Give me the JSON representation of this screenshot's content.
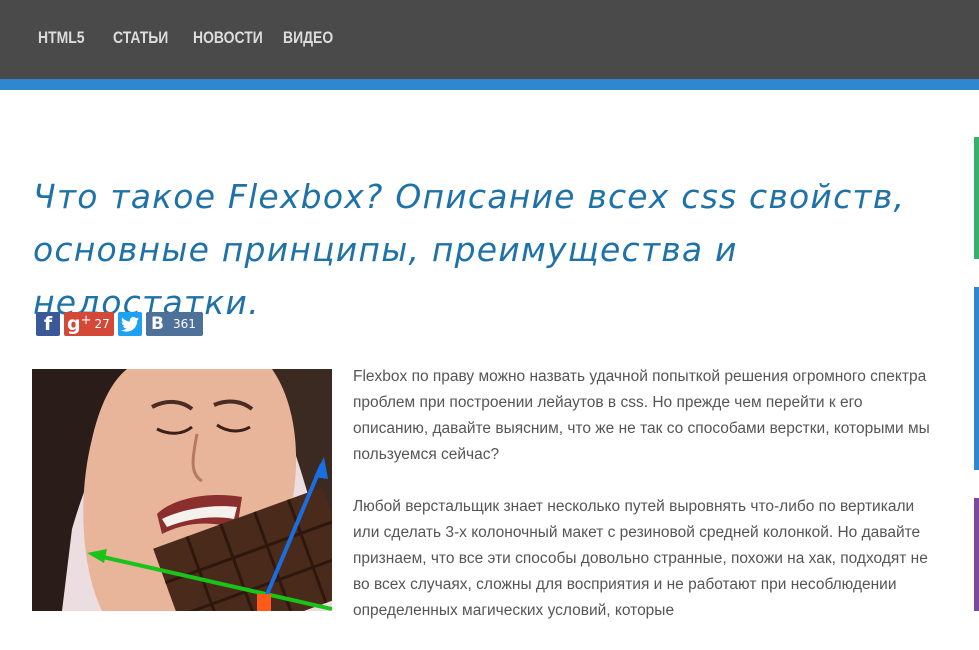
{
  "nav": {
    "items": [
      {
        "label": "HTML5"
      },
      {
        "label": "СТАТЬИ"
      },
      {
        "label": "НОВОСТИ"
      },
      {
        "label": "ВИДЕО"
      }
    ]
  },
  "article": {
    "title": "Что такое Flexbox? Описание всех css свойств, основные принципы, преимущества и недостатки.",
    "paragraphs": [
      "Flexbox по праву можно назвать удачной попыткой решения огромного спектра проблем при построении лейаутов в css. Но прежде чем перейти к его описанию, давайте выясним, что же не так со способами верстки, которыми мы пользуемся сейчас?",
      "Любой верстальщик знает несколько путей выровнять что-либо по вертикали или сделать 3-х колоночный макет с резиновой средней колонкой. Но давайте признаем, что все эти способы довольно странные, похожи на хак, подходят не во всех случаях, сложны для восприятия и не работают при несоблюдении определенных магических условий, которые"
    ]
  },
  "share": {
    "facebook_icon": "f",
    "googleplus_icon": "g",
    "googleplus_plus": "+",
    "googleplus_count": "27",
    "twitter_icon": "twitter-bird-icon",
    "vk_icon": "B",
    "vk_count": "361"
  },
  "colors": {
    "topbar": "#4a4a4a",
    "accent_blue": "#2e87cf",
    "title": "#1e72a8",
    "accent_green": "#36b06a",
    "accent_purple": "#7b4a9c"
  }
}
